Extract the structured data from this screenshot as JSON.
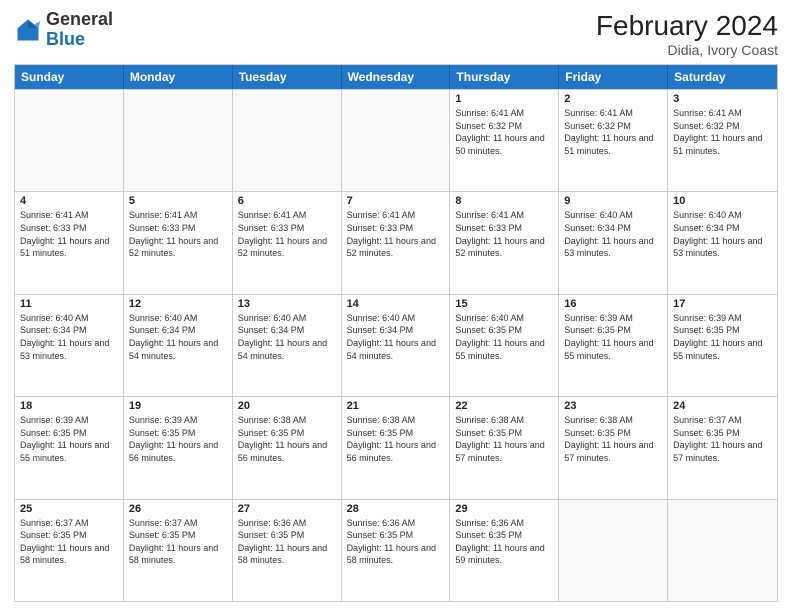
{
  "header": {
    "logo_general": "General",
    "logo_blue": "Blue",
    "month_year": "February 2024",
    "location": "Didia, Ivory Coast"
  },
  "days_of_week": [
    "Sunday",
    "Monday",
    "Tuesday",
    "Wednesday",
    "Thursday",
    "Friday",
    "Saturday"
  ],
  "weeks": [
    [
      {
        "day": "",
        "empty": true
      },
      {
        "day": "",
        "empty": true
      },
      {
        "day": "",
        "empty": true
      },
      {
        "day": "",
        "empty": true
      },
      {
        "day": "1",
        "sunrise": "Sunrise: 6:41 AM",
        "sunset": "Sunset: 6:32 PM",
        "daylight": "Daylight: 11 hours and 50 minutes."
      },
      {
        "day": "2",
        "sunrise": "Sunrise: 6:41 AM",
        "sunset": "Sunset: 6:32 PM",
        "daylight": "Daylight: 11 hours and 51 minutes."
      },
      {
        "day": "3",
        "sunrise": "Sunrise: 6:41 AM",
        "sunset": "Sunset: 6:32 PM",
        "daylight": "Daylight: 11 hours and 51 minutes."
      }
    ],
    [
      {
        "day": "4",
        "sunrise": "Sunrise: 6:41 AM",
        "sunset": "Sunset: 6:33 PM",
        "daylight": "Daylight: 11 hours and 51 minutes."
      },
      {
        "day": "5",
        "sunrise": "Sunrise: 6:41 AM",
        "sunset": "Sunset: 6:33 PM",
        "daylight": "Daylight: 11 hours and 52 minutes."
      },
      {
        "day": "6",
        "sunrise": "Sunrise: 6:41 AM",
        "sunset": "Sunset: 6:33 PM",
        "daylight": "Daylight: 11 hours and 52 minutes."
      },
      {
        "day": "7",
        "sunrise": "Sunrise: 6:41 AM",
        "sunset": "Sunset: 6:33 PM",
        "daylight": "Daylight: 11 hours and 52 minutes."
      },
      {
        "day": "8",
        "sunrise": "Sunrise: 6:41 AM",
        "sunset": "Sunset: 6:33 PM",
        "daylight": "Daylight: 11 hours and 52 minutes."
      },
      {
        "day": "9",
        "sunrise": "Sunrise: 6:40 AM",
        "sunset": "Sunset: 6:34 PM",
        "daylight": "Daylight: 11 hours and 53 minutes."
      },
      {
        "day": "10",
        "sunrise": "Sunrise: 6:40 AM",
        "sunset": "Sunset: 6:34 PM",
        "daylight": "Daylight: 11 hours and 53 minutes."
      }
    ],
    [
      {
        "day": "11",
        "sunrise": "Sunrise: 6:40 AM",
        "sunset": "Sunset: 6:34 PM",
        "daylight": "Daylight: 11 hours and 53 minutes."
      },
      {
        "day": "12",
        "sunrise": "Sunrise: 6:40 AM",
        "sunset": "Sunset: 6:34 PM",
        "daylight": "Daylight: 11 hours and 54 minutes."
      },
      {
        "day": "13",
        "sunrise": "Sunrise: 6:40 AM",
        "sunset": "Sunset: 6:34 PM",
        "daylight": "Daylight: 11 hours and 54 minutes."
      },
      {
        "day": "14",
        "sunrise": "Sunrise: 6:40 AM",
        "sunset": "Sunset: 6:34 PM",
        "daylight": "Daylight: 11 hours and 54 minutes."
      },
      {
        "day": "15",
        "sunrise": "Sunrise: 6:40 AM",
        "sunset": "Sunset: 6:35 PM",
        "daylight": "Daylight: 11 hours and 55 minutes."
      },
      {
        "day": "16",
        "sunrise": "Sunrise: 6:39 AM",
        "sunset": "Sunset: 6:35 PM",
        "daylight": "Daylight: 11 hours and 55 minutes."
      },
      {
        "day": "17",
        "sunrise": "Sunrise: 6:39 AM",
        "sunset": "Sunset: 6:35 PM",
        "daylight": "Daylight: 11 hours and 55 minutes."
      }
    ],
    [
      {
        "day": "18",
        "sunrise": "Sunrise: 6:39 AM",
        "sunset": "Sunset: 6:35 PM",
        "daylight": "Daylight: 11 hours and 55 minutes."
      },
      {
        "day": "19",
        "sunrise": "Sunrise: 6:39 AM",
        "sunset": "Sunset: 6:35 PM",
        "daylight": "Daylight: 11 hours and 56 minutes."
      },
      {
        "day": "20",
        "sunrise": "Sunrise: 6:38 AM",
        "sunset": "Sunset: 6:35 PM",
        "daylight": "Daylight: 11 hours and 56 minutes."
      },
      {
        "day": "21",
        "sunrise": "Sunrise: 6:38 AM",
        "sunset": "Sunset: 6:35 PM",
        "daylight": "Daylight: 11 hours and 56 minutes."
      },
      {
        "day": "22",
        "sunrise": "Sunrise: 6:38 AM",
        "sunset": "Sunset: 6:35 PM",
        "daylight": "Daylight: 11 hours and 57 minutes."
      },
      {
        "day": "23",
        "sunrise": "Sunrise: 6:38 AM",
        "sunset": "Sunset: 6:35 PM",
        "daylight": "Daylight: 11 hours and 57 minutes."
      },
      {
        "day": "24",
        "sunrise": "Sunrise: 6:37 AM",
        "sunset": "Sunset: 6:35 PM",
        "daylight": "Daylight: 11 hours and 57 minutes."
      }
    ],
    [
      {
        "day": "25",
        "sunrise": "Sunrise: 6:37 AM",
        "sunset": "Sunset: 6:35 PM",
        "daylight": "Daylight: 11 hours and 58 minutes."
      },
      {
        "day": "26",
        "sunrise": "Sunrise: 6:37 AM",
        "sunset": "Sunset: 6:35 PM",
        "daylight": "Daylight: 11 hours and 58 minutes."
      },
      {
        "day": "27",
        "sunrise": "Sunrise: 6:36 AM",
        "sunset": "Sunset: 6:35 PM",
        "daylight": "Daylight: 11 hours and 58 minutes."
      },
      {
        "day": "28",
        "sunrise": "Sunrise: 6:36 AM",
        "sunset": "Sunset: 6:35 PM",
        "daylight": "Daylight: 11 hours and 58 minutes."
      },
      {
        "day": "29",
        "sunrise": "Sunrise: 6:36 AM",
        "sunset": "Sunset: 6:35 PM",
        "daylight": "Daylight: 11 hours and 59 minutes."
      },
      {
        "day": "",
        "empty": true
      },
      {
        "day": "",
        "empty": true
      }
    ]
  ]
}
